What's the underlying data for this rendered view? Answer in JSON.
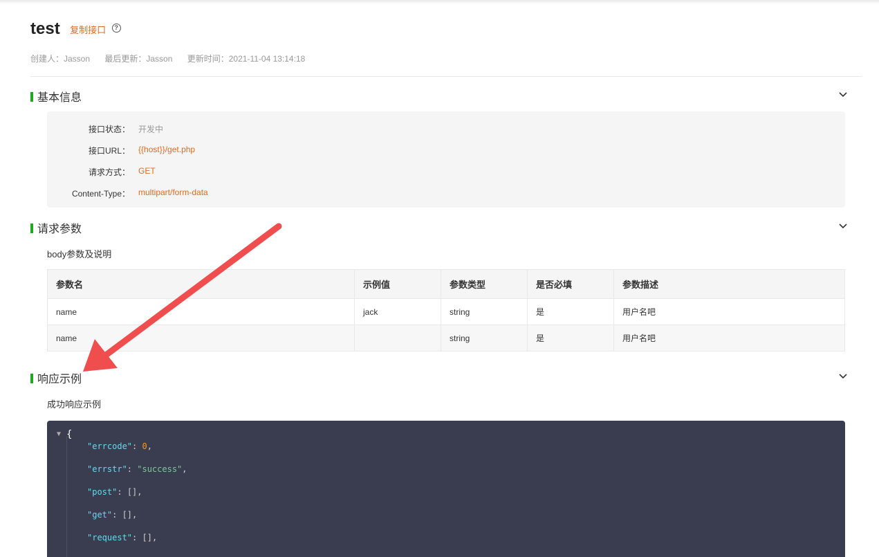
{
  "header": {
    "title": "test",
    "copy_label": "复制接口",
    "help_icon": "?"
  },
  "meta": {
    "creator": "创建人：Jasson",
    "last_updater": "最后更新：Jasson",
    "update_time": "更新时间：2021-11-04 13:14:18"
  },
  "basic_info": {
    "title": "基本信息",
    "rows": [
      {
        "label": "接口状态：",
        "value": "开发中"
      },
      {
        "label": "接口URL：",
        "value": "{{host}}/get.php"
      },
      {
        "label": "请求方式：",
        "value": "GET"
      },
      {
        "label": "Content-Type：",
        "value": "multipart/form-data"
      }
    ]
  },
  "request_params": {
    "title": "请求参数",
    "subtitle": "body参数及说明",
    "columns": [
      "参数名",
      "示例值",
      "参数类型",
      "是否必填",
      "参数描述"
    ],
    "rows": [
      [
        "name",
        "jack",
        "string",
        "是",
        "用户名吧"
      ],
      [
        "name",
        "",
        "string",
        "是",
        "用户名吧"
      ]
    ]
  },
  "response_example": {
    "title": "响应示例",
    "subtitle": "成功响应示例",
    "open_brace": "{",
    "collapse_marker": "▼",
    "lines": [
      {
        "key": "\"errcode\"",
        "sep": ": ",
        "value": "0",
        "tail": ",",
        "kind": "number"
      },
      {
        "key": "\"errstr\"",
        "sep": ": ",
        "value": "\"success\"",
        "tail": ",",
        "kind": "string"
      },
      {
        "key": "\"post\"",
        "sep": ": ",
        "value": "[]",
        "tail": ",",
        "kind": "punct"
      },
      {
        "key": "\"get\"",
        "sep": ": ",
        "value": "[]",
        "tail": ",",
        "kind": "punct"
      },
      {
        "key": "\"request\"",
        "sep": ": ",
        "value": "[]",
        "tail": ",",
        "kind": "punct"
      }
    ]
  },
  "colors": {
    "accent_green": "#1aad19",
    "accent_orange": "#e06c1f",
    "code_bg": "#393d4f",
    "annotation_arrow": "#f04e4e"
  },
  "icons": {
    "section_toggle": "chevron-down-icon",
    "help": "help-circle-icon"
  }
}
